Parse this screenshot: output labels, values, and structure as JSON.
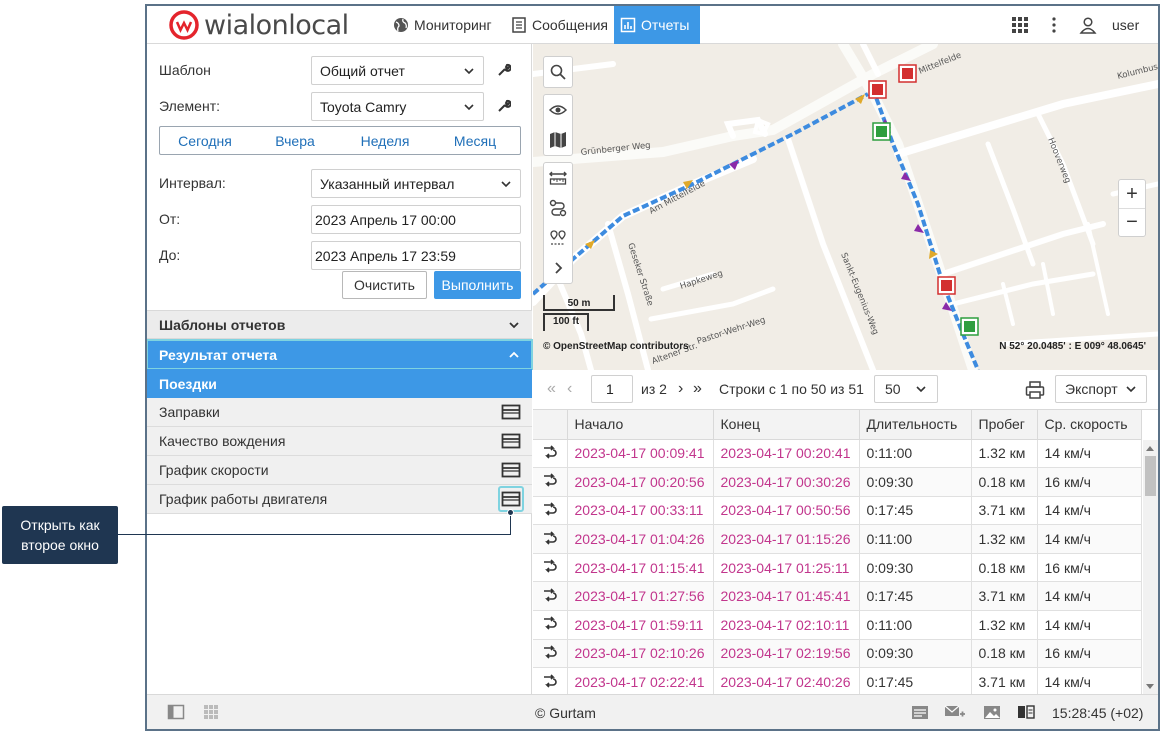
{
  "header": {
    "logo": {
      "brand": "wialon",
      "suffix": "local"
    },
    "nav": [
      {
        "label": "Мониторинг",
        "icon": "globe-icon",
        "active": false
      },
      {
        "label": "Сообщения",
        "icon": "document-icon",
        "active": false
      },
      {
        "label": "Отчеты",
        "icon": "chart-icon",
        "active": true
      }
    ],
    "user": "user"
  },
  "form": {
    "template_label": "Шаблон",
    "template_value": "Общий отчет",
    "element_label": "Элемент:",
    "element_value": "Toyota Camry",
    "periods": [
      "Сегодня",
      "Вчера",
      "Неделя",
      "Месяц"
    ],
    "interval_label": "Интервал:",
    "interval_value": "Указанный интервал",
    "from_label": "От:",
    "from_value": "2023 Апрель 17 00:00",
    "to_label": "До:",
    "to_value": "2023 Апрель 17 23:59",
    "clear_label": "Очистить",
    "run_label": "Выполнить"
  },
  "sections": {
    "templates": "Шаблоны отчетов",
    "result": "Результат отчета"
  },
  "result_items": [
    {
      "label": "Поездки",
      "active": true
    },
    {
      "label": "Заправки",
      "active": false
    },
    {
      "label": "Качество вождения",
      "active": false
    },
    {
      "label": "График скорости",
      "active": false
    },
    {
      "label": "График работы двигателя",
      "active": false
    }
  ],
  "map": {
    "streets": [
      "Grünberger Weg",
      "Am Mittelfelde",
      "Geseker Straße",
      "Hapkeweg",
      "Pastor-Wehr-Weg",
      "Sankt-Eugenius-Weg",
      "Hooverweg",
      "Mittelfelde",
      "Kolumbus",
      "Altener Str."
    ],
    "scale_m": "50 m",
    "scale_ft": "100 ft",
    "attribution": "© OpenStreetMap contributors",
    "coords": "N 52° 20.0485' : E 009° 48.0645'"
  },
  "toolbar": {
    "page": "1",
    "of_pages": "из 2",
    "rows_info": "Строки с 1 по 50 из 51",
    "per_page": "50",
    "export_label": "Экспорт"
  },
  "table": {
    "columns": [
      "",
      "Начало",
      "Конец",
      "Длительность",
      "Пробег",
      "Ср. скорость"
    ],
    "rows": [
      [
        "2023-04-17 00:09:41",
        "2023-04-17 00:20:41",
        "0:11:00",
        "1.32 км",
        "14 км/ч"
      ],
      [
        "2023-04-17 00:20:56",
        "2023-04-17 00:30:26",
        "0:09:30",
        "0.18 км",
        "16 км/ч"
      ],
      [
        "2023-04-17 00:33:11",
        "2023-04-17 00:50:56",
        "0:17:45",
        "3.71 км",
        "14 км/ч"
      ],
      [
        "2023-04-17 01:04:26",
        "2023-04-17 01:15:26",
        "0:11:00",
        "1.32 км",
        "14 км/ч"
      ],
      [
        "2023-04-17 01:15:41",
        "2023-04-17 01:25:11",
        "0:09:30",
        "0.18 км",
        "16 км/ч"
      ],
      [
        "2023-04-17 01:27:56",
        "2023-04-17 01:45:41",
        "0:17:45",
        "3.71 км",
        "14 км/ч"
      ],
      [
        "2023-04-17 01:59:11",
        "2023-04-17 02:10:11",
        "0:11:00",
        "1.32 км",
        "14 км/ч"
      ],
      [
        "2023-04-17 02:10:26",
        "2023-04-17 02:19:56",
        "0:09:30",
        "0.18 км",
        "16 км/ч"
      ],
      [
        "2023-04-17 02:22:41",
        "2023-04-17 02:40:26",
        "0:17:45",
        "3.71 км",
        "14 км/ч"
      ]
    ]
  },
  "footer": {
    "copyright": "© Gurtam",
    "clock": "15:28:45 (+02)"
  },
  "callout": "Открыть как второе окно",
  "colors": {
    "accent": "#3d98e6",
    "time_link": "#c2368d",
    "callout_bg": "#1f3651"
  }
}
